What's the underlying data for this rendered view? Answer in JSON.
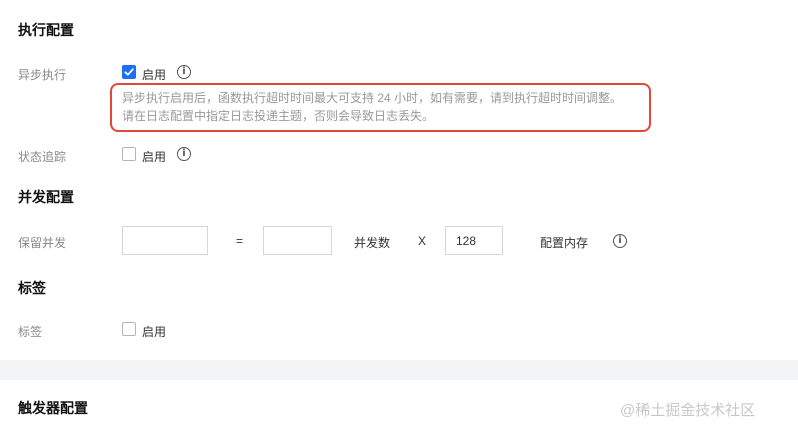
{
  "exec_config": {
    "title": "执行配置",
    "async": {
      "label": "异步执行",
      "checkbox_label": "启用",
      "checked": true,
      "description_line1": "异步执行启用后，函数执行超时时间最大可支持 24 小时，如有需要，请到执行超时时间调整。",
      "description_line2": "请在日志配置中指定日志投递主题，否则会导致日志丢失。"
    },
    "tracking": {
      "label": "状态追踪",
      "checkbox_label": "启用",
      "checked": false
    }
  },
  "concurrency": {
    "title": "并发配置",
    "reserved_label": "保留并发",
    "input1_value": "",
    "equals": "=",
    "input2_value": "",
    "concurrency_count_label": "并发数",
    "times": "X",
    "memory_value": "128",
    "memory_label": "配置内存"
  },
  "tags": {
    "title": "标签",
    "label": "标签",
    "checkbox_label": "启用",
    "checked": false
  },
  "trigger": {
    "title": "触发器配置"
  },
  "watermark": "@稀土掘金技术社区",
  "icons": {
    "info": "info-icon",
    "check": "checkmark-icon"
  },
  "colors": {
    "accent": "#1f6ff5",
    "highlight": "#e0483a"
  }
}
